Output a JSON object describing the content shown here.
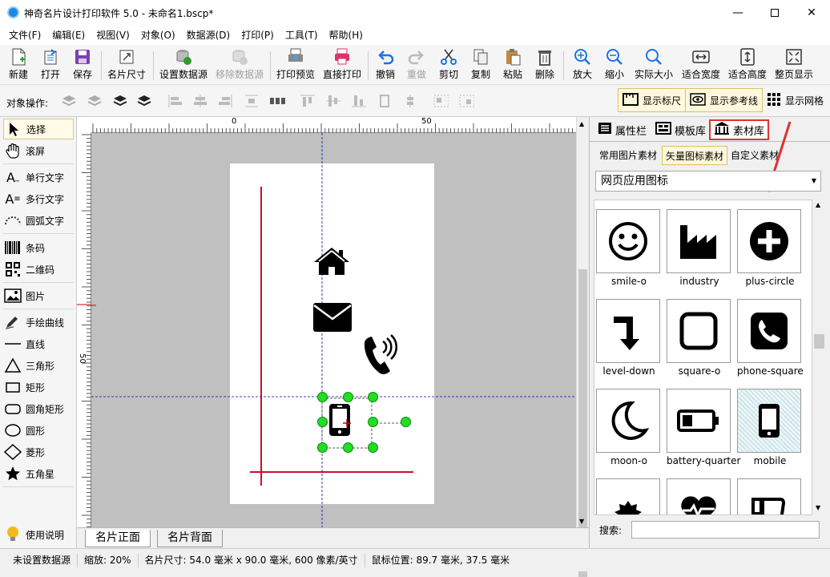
{
  "window": {
    "title": "神奇名片设计打印软件 5.0 - 未命名1.bscp*"
  },
  "menu": [
    "文件(F)",
    "编辑(E)",
    "视图(V)",
    "对象(O)",
    "数据源(D)",
    "打印(P)",
    "工具(T)",
    "帮助(H)"
  ],
  "toolbar": {
    "new": "新建",
    "open": "打开",
    "save": "保存",
    "card_size": "名片尺寸",
    "set_datasource": "设置数据源",
    "remove_datasource": "移除数据源",
    "print_preview": "打印预览",
    "direct_print": "直接打印",
    "undo": "撤销",
    "redo": "重做",
    "cut": "剪切",
    "copy": "复制",
    "paste": "粘贴",
    "delete": "删除",
    "zoom_in": "放大",
    "zoom_out": "缩小",
    "actual_size": "实际大小",
    "fit_width": "适合宽度",
    "fit_height": "适合高度",
    "fit_page": "整页显示"
  },
  "toolbar2": {
    "label": "对象操作:",
    "show_ruler": "显示标尺",
    "show_guides": "显示参考线",
    "show_grid": "显示网格"
  },
  "tools": [
    "选择",
    "滚屏",
    "单行文字",
    "多行文字",
    "圆弧文字",
    "条码",
    "二维码",
    "图片",
    "手绘曲线",
    "直线",
    "三角形",
    "矩形",
    "圆角矩形",
    "圆形",
    "菱形",
    "五角星",
    "使用说明"
  ],
  "ruler": {
    "top": [
      "0",
      "50"
    ],
    "left": [
      "50"
    ]
  },
  "canvas_tabs": [
    "名片正面",
    "名片背面"
  ],
  "right_panel": {
    "tabs": [
      "属性栏",
      "模板库",
      "素材库"
    ],
    "subtabs": [
      "常用图片素材",
      "矢量图标素材",
      "自定义素材"
    ],
    "category": "网页应用图标",
    "icons": [
      "smile-o",
      "industry",
      "plus-circle",
      "level-down",
      "square-o",
      "phone-square",
      "moon-o",
      "battery-quarter",
      "mobile"
    ],
    "search_label": "搜索:"
  },
  "status": {
    "datasource": "未设置数据源",
    "zoom": "缩放: 20%",
    "card_size": "名片尺寸: 54.0 毫米 x 90.0 毫米, 600 像素/英寸",
    "mouse": "鼠标位置: 89.7 毫米, 37.5 毫米"
  }
}
